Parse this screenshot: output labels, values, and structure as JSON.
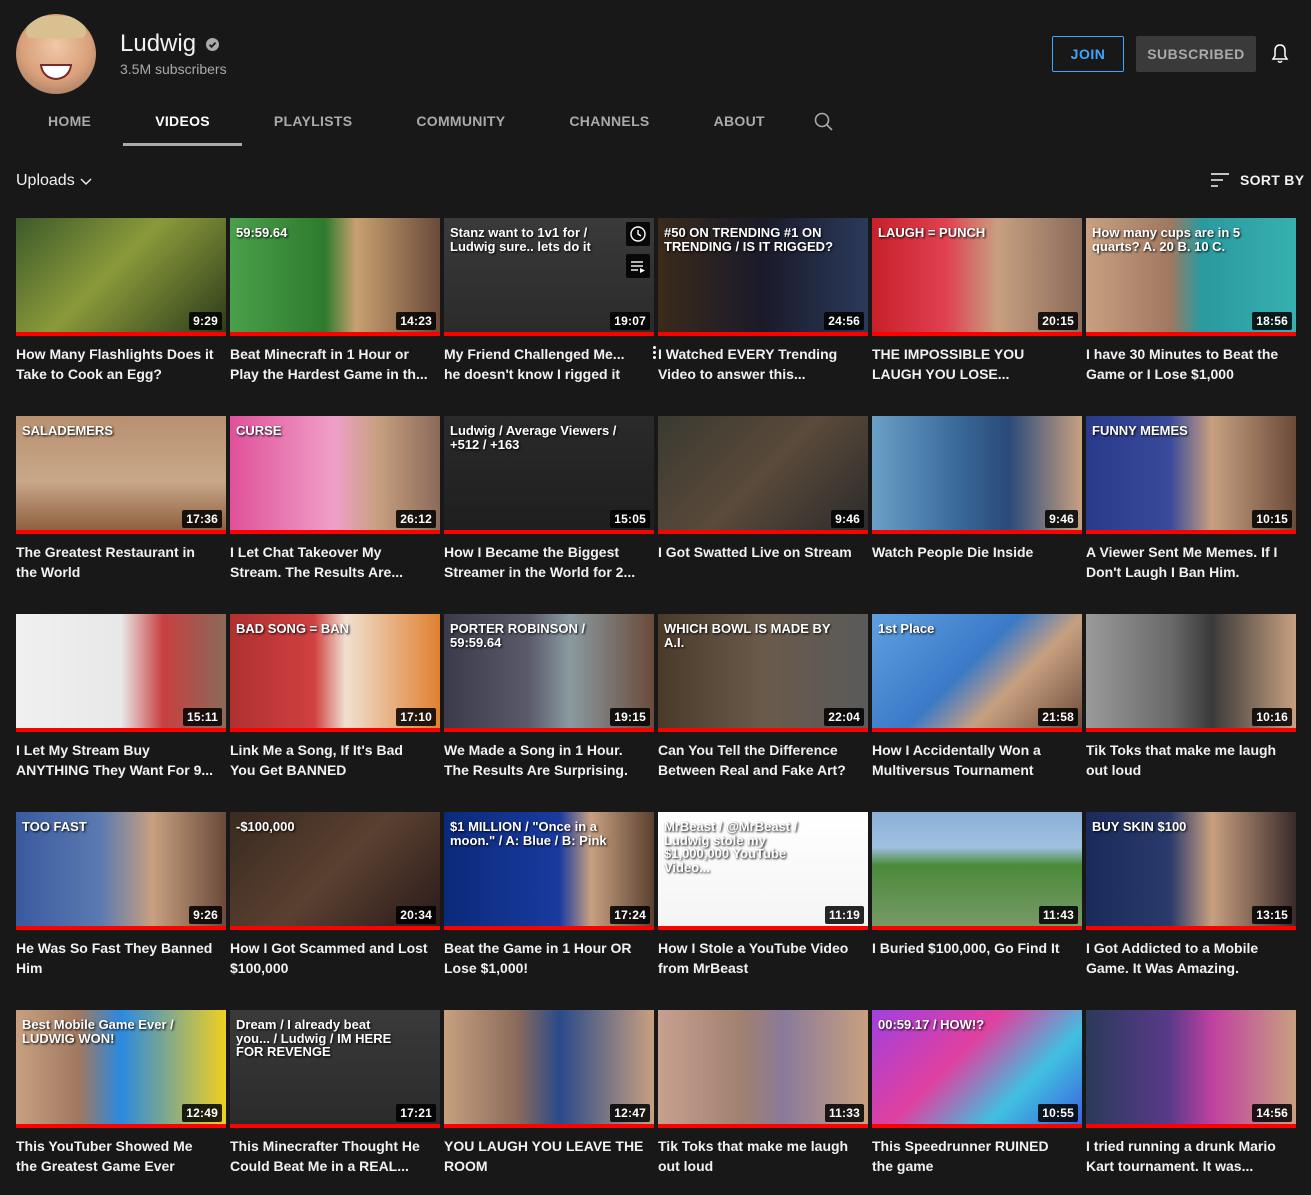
{
  "channel": {
    "name": "Ludwig",
    "subscribers": "3.5M subscribers",
    "join_label": "JOIN",
    "subscribed_label": "SUBSCRIBED"
  },
  "tabs": [
    {
      "label": "HOME"
    },
    {
      "label": "VIDEOS"
    },
    {
      "label": "PLAYLISTS"
    },
    {
      "label": "COMMUNITY"
    },
    {
      "label": "CHANNELS"
    },
    {
      "label": "ABOUT"
    }
  ],
  "active_tab": "VIDEOS",
  "filter": {
    "uploads_label": "Uploads",
    "sort_label": "SORT BY"
  },
  "colors": {
    "accent_blue": "#3ea6ff",
    "progress_red": "#ff0000",
    "background": "#181818"
  },
  "videos": [
    {
      "title": "How Many Flashlights Does it Take to Cook an Egg?",
      "duration": "9:29",
      "thumb_text": "",
      "bg": "linear-gradient(135deg,#3d5a2a,#8a9a3a 45%,#2b3a1a)"
    },
    {
      "title": "Beat Minecraft in 1 Hour or Play the Hardest Game in th...",
      "duration": "14:23",
      "thumb_text": "59:59.64",
      "bg": "linear-gradient(90deg,#4aa04a 0%,#2e7a2e 45%,#c8a070 60%,#6a4a3a 100%)"
    },
    {
      "title": "My Friend Challenged Me... he doesn't know I rigged it",
      "duration": "19:07",
      "thumb_text": "Stanz want to 1v1 for / Ludwig sure.. lets do it",
      "bg": "linear-gradient(180deg,#3a3a3a,#2a2a2a)"
    },
    {
      "title": "I Watched EVERY Trending Video to answer this...",
      "duration": "24:56",
      "thumb_text": "#50 ON TRENDING  #1 ON TRENDING / IS IT RIGGED?",
      "bg": "linear-gradient(90deg,#3a2a1a,#1a1a2a 50%,#2a3a5a)"
    },
    {
      "title": "THE IMPOSSIBLE YOU LAUGH YOU LOSE...",
      "duration": "20:15",
      "thumb_text": "LAUGH = PUNCH",
      "bg": "linear-gradient(90deg,#c8202a,#e04050 35%,#c8a080 60%,#8a6a5a)"
    },
    {
      "title": "I have 30 Minutes to Beat the Game or I Lose $1,000",
      "duration": "18:56",
      "thumb_text": "How many cups are in 5 quarts? A. 20 B. 10 C.",
      "bg": "linear-gradient(90deg,#c8a080,#a07860 40%,#2a9aa0 55%,#36b0b0)"
    },
    {
      "title": "The Greatest Restaurant in the World",
      "duration": "17:36",
      "thumb_text": "SALADEMERS",
      "bg": "linear-gradient(180deg,#b89070 0%,#c8a888 55%,#8a5a3a 100%)"
    },
    {
      "title": "I Let Chat Takeover My Stream. The Results Are...",
      "duration": "26:12",
      "thumb_text": "CURSE",
      "bg": "linear-gradient(90deg,#e0509a,#f0a0c8 50%,#c8a080 70%,#8a6a5a)"
    },
    {
      "title": "How I Became the Biggest Streamer in the World for 2...",
      "duration": "15:05",
      "thumb_text": "Ludwig / Average Viewers / +512 / +163",
      "bg": "linear-gradient(180deg,#2a2a2a,#1e1e1e)"
    },
    {
      "title": "I Got Swatted Live on Stream",
      "duration": "9:46",
      "thumb_text": "",
      "bg": "linear-gradient(135deg,#3a3a30,#5a4a3a 50%,#2a2a2a)"
    },
    {
      "title": "Watch People Die Inside",
      "duration": "9:46",
      "thumb_text": "",
      "bg": "linear-gradient(90deg,#6aa0c8,#3a6a9a 40%,#2a4a7a 65%,#c8a080)"
    },
    {
      "title": "A Viewer Sent Me Memes. If I Don't Laugh I Ban Him.",
      "duration": "10:15",
      "thumb_text": "FUNNY MEMES",
      "bg": "linear-gradient(90deg,#2a3a8a,#3a4a9a 40%,#c8a080 60%,#6a4a3a)"
    },
    {
      "title": "I Let My Stream Buy ANYTHING They Want For 9...",
      "duration": "15:11",
      "thumb_text": "",
      "bg": "linear-gradient(90deg,#f0f0f0,#e8e8e8 50%,#c84040 70%,#8a6a5a)"
    },
    {
      "title": "Link Me a Song, If It's Bad You Get BANNED",
      "duration": "17:10",
      "thumb_text": "BAD SONG = BAN",
      "bg": "linear-gradient(90deg,#b03030,#d04040 40%,#f0e0d0 55%,#e08030)"
    },
    {
      "title": "We Made a Song in 1 Hour. The Results Are Surprising.",
      "duration": "19:15",
      "thumb_text": "PORTER ROBINSON / 59:59.64",
      "bg": "linear-gradient(90deg,#3a3a4a,#5a5a6a 40%,#8a9aa0 60%,#6a4a3a)"
    },
    {
      "title": "Can You Tell the Difference Between Real and Fake Art?",
      "duration": "22:04",
      "thumb_text": "WHICH BOWL IS MADE BY A.I.",
      "bg": "linear-gradient(90deg,#4a3a2a,#6a5a4a 50%,#5a5a5a)"
    },
    {
      "title": "How I Accidentally Won a Multiversus Tournament",
      "duration": "21:58",
      "thumb_text": "1st Place",
      "bg": "linear-gradient(135deg,#60a0e0,#3a7ac8 45%,#c8a080 65%,#6a4a3a)"
    },
    {
      "title": "Tik Toks that make me laugh out loud",
      "duration": "10:16",
      "thumb_text": "",
      "bg": "linear-gradient(90deg,#9a9a9a,#6a6a6a 40%,#3a3a3a 60%,#c8a080)"
    },
    {
      "title": "He Was So Fast They Banned Him",
      "duration": "9:26",
      "thumb_text": "TOO FAST",
      "bg": "linear-gradient(90deg,#3a5aa0,#5a7ab0 40%,#c8a080 65%,#6a4a3a)"
    },
    {
      "title": "How I Got Scammed and Lost $100,000",
      "duration": "20:34",
      "thumb_text": "-$100,000",
      "bg": "linear-gradient(135deg,#3a2a20,#5a4030 50%,#2a1a1a)"
    },
    {
      "title": "Beat the Game in 1 Hour OR Lose $1,000!",
      "duration": "17:24",
      "thumb_text": "$1 MILLION / \"Once in a moon.\" / A: Blue / B: Pink",
      "bg": "linear-gradient(90deg,#0a2a7a,#1a3aa0 55%,#c8a080 70%,#5a4030)"
    },
    {
      "title": "How I Stole a YouTube Video from MrBeast",
      "duration": "11:19",
      "thumb_text": "MrBeast / @MrBeast / Ludwig stole my $1,000,000 YouTube Video...",
      "bg": "linear-gradient(180deg,#ffffff,#f4f4f4)"
    },
    {
      "title": "I Buried $100,000, Go Find It",
      "duration": "11:43",
      "thumb_text": "",
      "bg": "linear-gradient(180deg,#8ab0d8 0%,#a0c0e0 30%,#4a8a3a 45%,#7a9a6a 100%)"
    },
    {
      "title": "I Got Addicted to a Mobile Game. It Was Amazing.",
      "duration": "13:15",
      "thumb_text": "BUY SKIN $100",
      "bg": "linear-gradient(90deg,#1a2a5a,#2a3a6a 40%,#c8a080 60%,#3a2a2a)"
    },
    {
      "title": "This YouTuber Showed Me the Greatest Game Ever",
      "duration": "12:49",
      "thumb_text": "Best Mobile Game Ever / LUDWIG WON!",
      "bg": "linear-gradient(90deg,#c8a080,#a07860 30%,#2a8ae0 50%,#f0d020)"
    },
    {
      "title": "This Minecrafter Thought He Could Beat Me in a REAL...",
      "duration": "17:21",
      "thumb_text": "Dream / I already beat you... / Ludwig / IM HERE FOR REVENGE",
      "bg": "linear-gradient(180deg,#3a3a3a,#2a2a2a)"
    },
    {
      "title": "YOU LAUGH YOU LEAVE THE ROOM",
      "duration": "12:47",
      "thumb_text": "",
      "bg": "linear-gradient(90deg,#c8a080,#8a6a5a 35%,#2a4a8a 55%,#c8a080)"
    },
    {
      "title": "Tik Toks that make me laugh out loud",
      "duration": "11:33",
      "thumb_text": "",
      "bg": "linear-gradient(90deg,#c8a090,#a08070 40%,#8a7a9a 60%,#c8a080)"
    },
    {
      "title": "This Speedrunner RUINED the game",
      "duration": "10:55",
      "thumb_text": "00:59.17 / HOW!?",
      "bg": "linear-gradient(135deg,#a040e0,#e040a0 40%,#40c0e0 70%,#3a60e0)"
    },
    {
      "title": "I tried running a drunk Mario Kart tournament. It was...",
      "duration": "14:56",
      "thumb_text": "",
      "bg": "linear-gradient(90deg,#2a3a5a,#5a3a8a 40%,#c040a0 60%,#c8a080)"
    }
  ]
}
